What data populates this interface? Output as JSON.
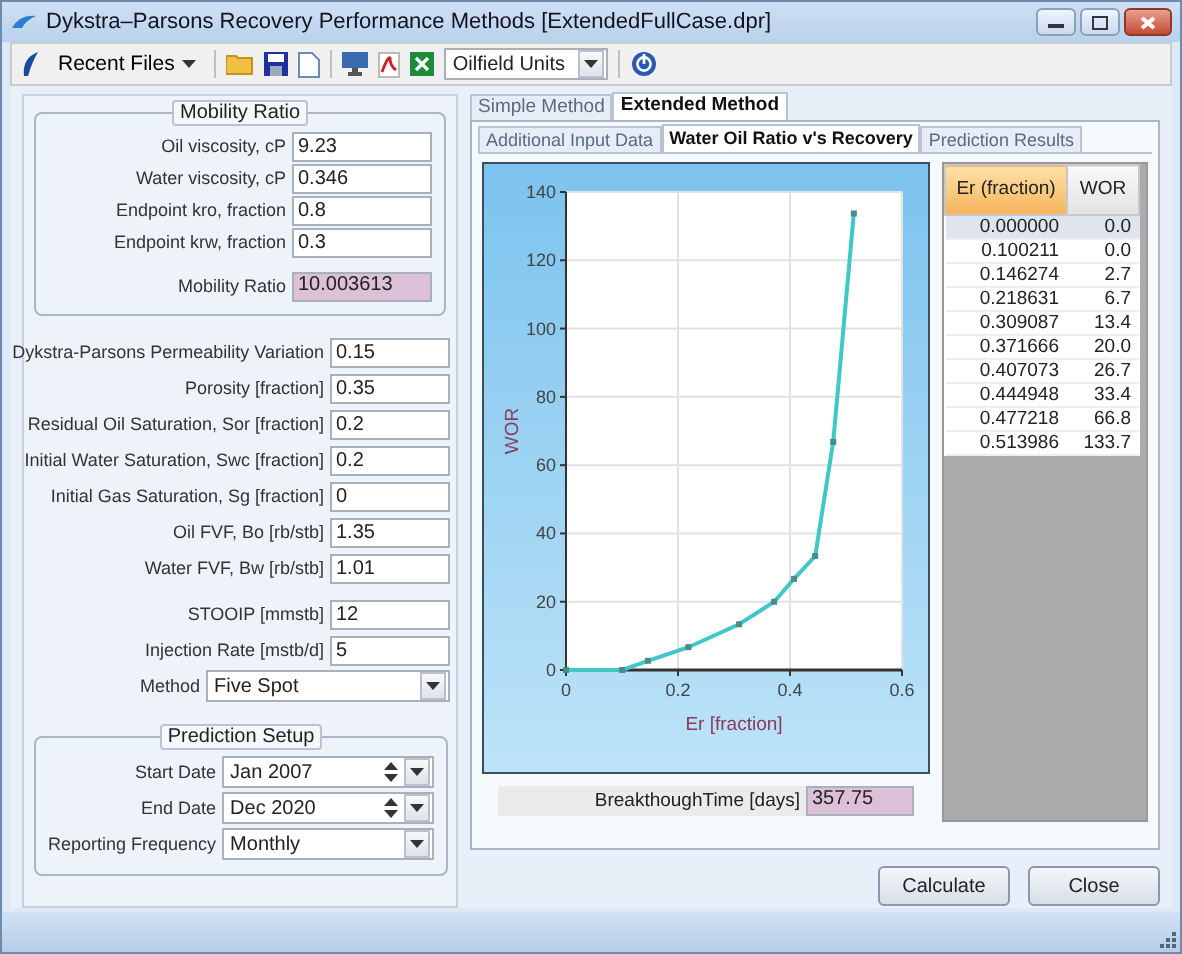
{
  "window": {
    "title": "Dykstra–Parsons Recovery Performance Methods [ExtendedFullCase.dpr]"
  },
  "toolbar": {
    "recent_files": "Recent Files",
    "units": "Oilfield Units"
  },
  "mobility_ratio": {
    "title": "Mobility Ratio",
    "fields": [
      {
        "label": "Oil viscosity, cP",
        "value": "9.23"
      },
      {
        "label": "Water viscosity, cP",
        "value": "0.346"
      },
      {
        "label": "Endpoint kro, fraction",
        "value": "0.8"
      },
      {
        "label": "Endpoint krw, fraction",
        "value": "0.3"
      }
    ],
    "result": {
      "label": "Mobility Ratio",
      "value": "10.003613"
    }
  },
  "reservoir_fields": [
    {
      "label": "Dykstra-Parsons Permeability Variation",
      "value": "0.15"
    },
    {
      "label": "Porosity [fraction]",
      "value": "0.35"
    },
    {
      "label": "Residual Oil Saturation, Sor [fraction]",
      "value": "0.2"
    },
    {
      "label": "Initial Water Saturation, Swc [fraction]",
      "value": "0.2"
    },
    {
      "label": "Initial Gas Saturation, Sg [fraction]",
      "value": "0"
    },
    {
      "label": "Oil FVF, Bo [rb/stb]",
      "value": "1.35"
    },
    {
      "label": "Water FVF, Bw [rb/stb]",
      "value": "1.01"
    }
  ],
  "injection_fields": [
    {
      "label": "STOOIP [mmstb]",
      "value": "12"
    },
    {
      "label": "Injection Rate [mstb/d]",
      "value": "5"
    }
  ],
  "method": {
    "label": "Method",
    "value": "Five Spot"
  },
  "prediction_setup": {
    "title": "Prediction Setup",
    "start_date": {
      "label": "Start Date",
      "value": "Jan 2007"
    },
    "end_date": {
      "label": "End Date",
      "value": "Dec 2020"
    },
    "reporting_frequency": {
      "label": "Reporting Frequency",
      "value": "Monthly"
    }
  },
  "outer_tabs": [
    {
      "label": "Simple Method",
      "selected": false
    },
    {
      "label": "Extended Method",
      "selected": true
    }
  ],
  "inner_tabs": [
    {
      "label": "Additional Input Data",
      "selected": false
    },
    {
      "label": "Water Oil Ratio v's Recovery",
      "selected": true
    },
    {
      "label": "Prediction Results",
      "selected": false
    }
  ],
  "chart": {
    "chart_data": {
      "type": "line",
      "xlabel": "Er [fraction]",
      "ylabel": "WOR",
      "x": [
        0.0,
        0.100211,
        0.146274,
        0.218631,
        0.309087,
        0.371666,
        0.407073,
        0.444948,
        0.477218,
        0.513986
      ],
      "grid": true,
      "series": [
        {
          "color": "#40c8c8",
          "marker": true,
          "values": [
            0.0,
            0.0,
            2.7,
            6.7,
            13.4,
            20.0,
            26.7,
            33.4,
            66.8,
            133.7
          ]
        }
      ],
      "xlim": [
        0,
        0.6
      ],
      "ylim": [
        0,
        140
      ],
      "xticks": [
        0,
        0.2,
        0.4,
        0.6
      ],
      "yticks": [
        0,
        20,
        40,
        60,
        80,
        100,
        120,
        140
      ]
    }
  },
  "breakthrough": {
    "label": "BreakthoughTime [days]",
    "value": "357.75"
  },
  "table": {
    "columns": [
      "Er (fraction)",
      "WOR"
    ],
    "rows": [
      {
        "cells": [
          "0.000000",
          "0.0"
        ],
        "selected": true
      },
      {
        "cells": [
          "0.100211",
          "0.0"
        ],
        "selected": false
      },
      {
        "cells": [
          "0.146274",
          "2.7"
        ],
        "selected": false
      },
      {
        "cells": [
          "0.218631",
          "6.7"
        ],
        "selected": false
      },
      {
        "cells": [
          "0.309087",
          "13.4"
        ],
        "selected": false
      },
      {
        "cells": [
          "0.371666",
          "20.0"
        ],
        "selected": false
      },
      {
        "cells": [
          "0.407073",
          "26.7"
        ],
        "selected": false
      },
      {
        "cells": [
          "0.444948",
          "33.4"
        ],
        "selected": false
      },
      {
        "cells": [
          "0.477218",
          "66.8"
        ],
        "selected": false
      },
      {
        "cells": [
          "0.513986",
          "133.7"
        ],
        "selected": false
      }
    ]
  },
  "buttons": [
    "Calculate",
    "Close"
  ]
}
